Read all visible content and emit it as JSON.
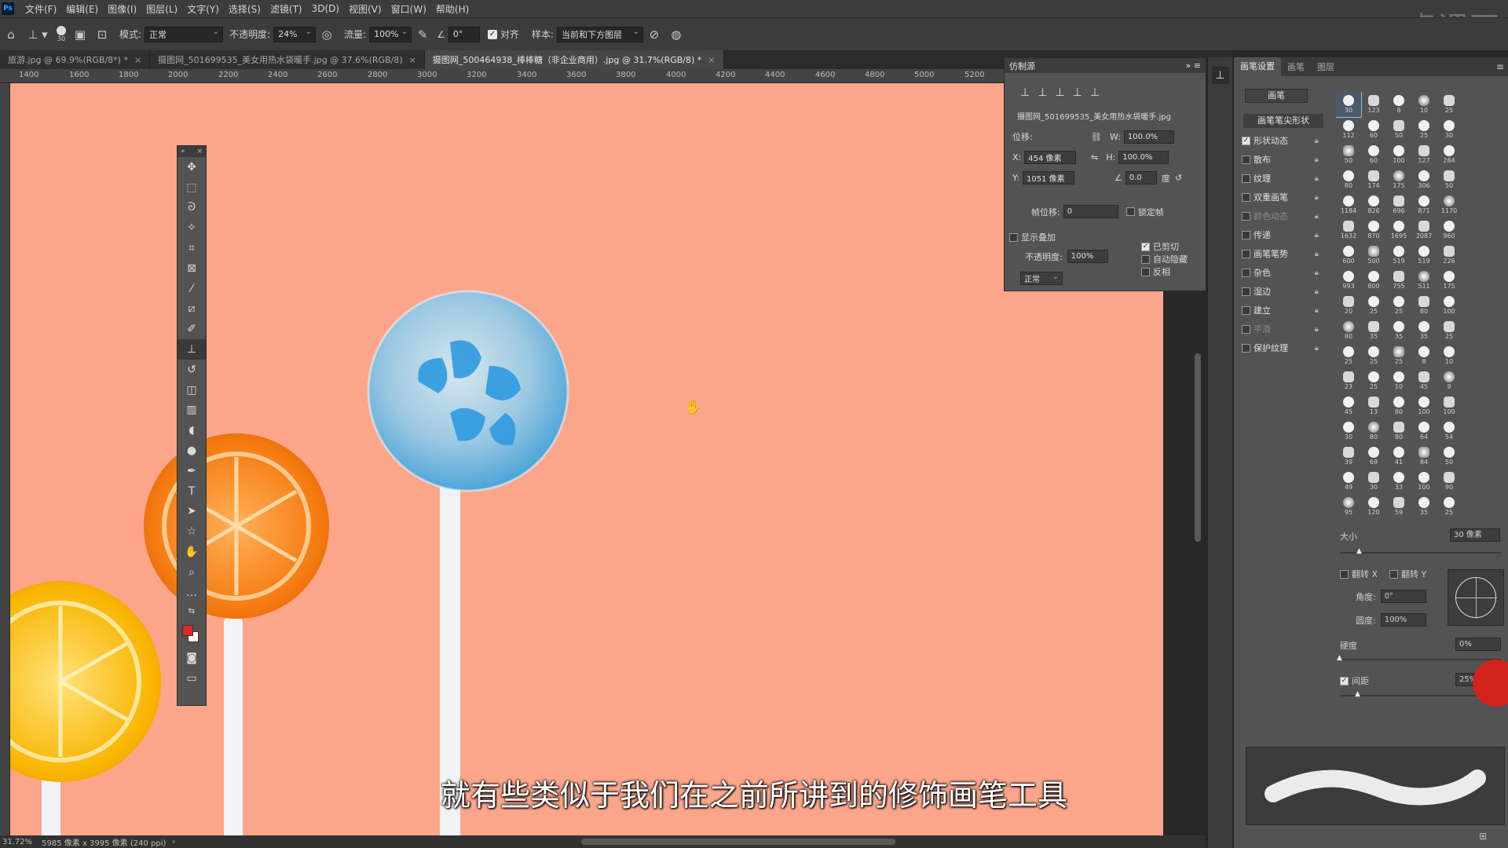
{
  "menubar": {
    "logo": "Ps",
    "items": [
      "文件(F)",
      "编辑(E)",
      "图像(I)",
      "图层(L)",
      "文字(Y)",
      "选择(S)",
      "滤镜(T)",
      "3D(D)",
      "视图(V)",
      "窗口(W)",
      "帮助(H)"
    ]
  },
  "options": {
    "brush_size": "30",
    "mode_label": "模式:",
    "mode_value": "正常",
    "opacity_label": "不透明度:",
    "opacity_value": "24%",
    "flow_label": "流量:",
    "flow_value": "100%",
    "angle_value": "0°",
    "align_label": "对齐",
    "sample_label": "样本:",
    "sample_value": "当前和下方图层"
  },
  "tabs": [
    {
      "label": "旅游.jpg @ 69.9%(RGB/8*) *",
      "active": false
    },
    {
      "label": "摄图网_501699535_美女用热水袋暖手.jpg @ 37.6%(RGB/8)",
      "active": false
    },
    {
      "label": "摄图网_500464938_棒棒糖（非企业商用）.jpg @ 31.7%(RGB/8) *",
      "active": true
    }
  ],
  "ruler_ticks": [
    "1400",
    "1600",
    "1800",
    "2000",
    "2200",
    "2400",
    "2600",
    "2800",
    "3000",
    "3200",
    "3400",
    "3600",
    "3800",
    "4000",
    "4200",
    "4400",
    "4600",
    "4800",
    "5000",
    "5200"
  ],
  "status": {
    "zoom": "31.72%",
    "doc_info": "5985 像素 x 3995 像素 (240 ppi)"
  },
  "clone_source": {
    "title": "仿制源",
    "filename": "摄图网_501699535_美女用热水袋暖手.jpg",
    "offset_label": "位移:",
    "w_label": "W:",
    "w_value": "100.0%",
    "h_label": "H:",
    "h_value": "100.0%",
    "x_label": "X:",
    "x_value": "454 像素",
    "y_label": "Y:",
    "y_value": "1051 像素",
    "angle_value": "0.0",
    "angle_unit": "度",
    "frame_offset_label": "帧位移:",
    "frame_offset_value": "0",
    "lock_frame_label": "锁定帧",
    "show_overlay_label": "显示叠加",
    "clipped_label": "已剪切",
    "auto_hide_label": "自动隐藏",
    "invert_label": "反相",
    "overlay_opacity_label": "不透明度:",
    "overlay_opacity_value": "100%",
    "blend_mode": "正常"
  },
  "brush_settings": {
    "tabs": [
      "画笔设置",
      "画笔",
      "图层"
    ],
    "brushes_button": "画笔",
    "tip_shape_label": "画笔笔尖形状",
    "options": [
      {
        "label": "形状动态",
        "checked": true,
        "dim": false
      },
      {
        "label": "散布",
        "checked": false,
        "dim": false
      },
      {
        "label": "纹理",
        "checked": false,
        "dim": false
      },
      {
        "label": "双重画笔",
        "checked": false,
        "dim": false
      },
      {
        "label": "颜色动态",
        "checked": false,
        "dim": true
      },
      {
        "label": "传递",
        "checked": false,
        "dim": false
      },
      {
        "label": "画笔笔势",
        "checked": false,
        "dim": false
      },
      {
        "label": "杂色",
        "checked": false,
        "dim": false
      },
      {
        "label": "湿边",
        "checked": false,
        "dim": false
      },
      {
        "label": "建立",
        "checked": false,
        "dim": false
      },
      {
        "label": "平滑",
        "checked": false,
        "dim": true
      },
      {
        "label": "保护纹理",
        "checked": false,
        "dim": false
      }
    ],
    "brush_sizes": [
      "30",
      "123",
      "8",
      "10",
      "25",
      "112",
      "60",
      "50",
      "25",
      "30",
      "50",
      "60",
      "100",
      "127",
      "284",
      "80",
      "174",
      "175",
      "306",
      "50",
      "1184",
      "826",
      "696",
      "871",
      "1170",
      "1632",
      "870",
      "1695",
      "2087",
      "960",
      "600",
      "500",
      "519",
      "519",
      "226",
      "993",
      "800",
      "755",
      "511",
      "175",
      "20",
      "25",
      "25",
      "80",
      "100",
      "80",
      "35",
      "35",
      "35",
      "25",
      "25",
      "25",
      "25",
      "8",
      "10",
      "23",
      "25",
      "10",
      "45",
      "9",
      "45",
      "13",
      "80",
      "100",
      "100",
      "30",
      "80",
      "80",
      "64",
      "54",
      "39",
      "69",
      "41",
      "84",
      "50",
      "49",
      "30",
      "33",
      "100",
      "90",
      "95",
      "120",
      "59",
      "35",
      "25"
    ],
    "size_label": "大小",
    "size_value": "30 像素",
    "flip_x_label": "翻转 X",
    "flip_y_label": "翻转 Y",
    "angle_label": "角度:",
    "angle_value": "0°",
    "roundness_label": "圆度:",
    "roundness_value": "100%",
    "hardness_label": "硬度",
    "hardness_value": "0%",
    "spacing_label": "间距",
    "spacing_value": "25%"
  },
  "subtitle": "就有些类似于我们在之前所讲到的修饰画笔工具",
  "watermark": "虎课网"
}
